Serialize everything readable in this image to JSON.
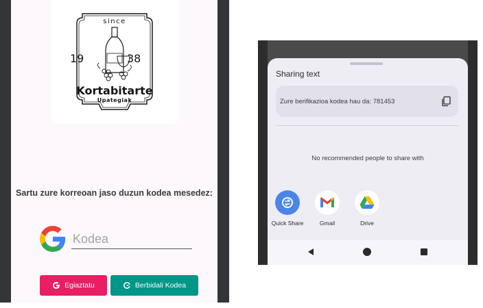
{
  "left": {
    "logo": {
      "since": "since",
      "year_left": "19",
      "year_right": "38",
      "brand": "Kortabitarte",
      "subtitle": "Upategiak"
    },
    "prompt": "Sartu zure korreoan jaso duzun kodea mesedez:",
    "code_input": {
      "placeholder": "Kodea",
      "value": ""
    },
    "verify_button": "Egiaztatu",
    "resend_button": "Berbidali Kodea",
    "colors": {
      "verify": "#e91e63",
      "resend": "#009688"
    }
  },
  "right": {
    "sheet_title": "Sharing text",
    "shared_text": "Zure berifikazioa kodea hau da: 781453",
    "no_people": "No recommended people to share with",
    "apps": [
      {
        "label": "Quick Share",
        "icon": "quick-share-icon"
      },
      {
        "label": "Gmail",
        "icon": "gmail-icon"
      },
      {
        "label": "Drive",
        "icon": "drive-icon"
      }
    ]
  }
}
